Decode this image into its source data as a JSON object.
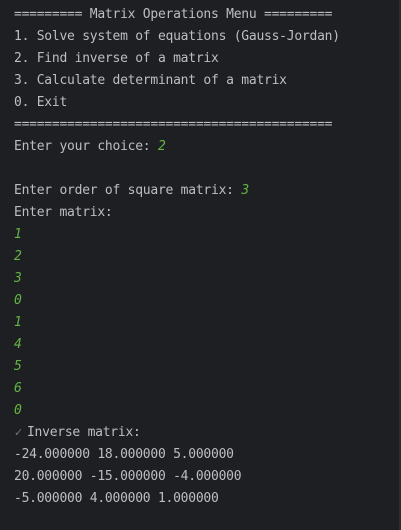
{
  "console": {
    "menu_header": "========= Matrix Operations Menu =========",
    "menu_items": [
      "1. Solve system of equations (Gauss-Jordan)",
      "2. Find inverse of a matrix",
      "3. Calculate determinant of a matrix",
      "0. Exit"
    ],
    "menu_footer": "==========================================",
    "choice_prompt": "Enter your choice: ",
    "choice_value": "2",
    "order_prompt": "Enter order of square matrix: ",
    "order_value": "3",
    "matrix_prompt": "Enter matrix:",
    "matrix_inputs": [
      "1",
      "2",
      "3",
      "0",
      "1",
      "4",
      "5",
      "6",
      "0"
    ],
    "check_icon": "✓",
    "result_label": "Inverse matrix:",
    "result_rows": [
      "-24.000000 18.000000 5.000000",
      "20.000000 -15.000000 -4.000000",
      "-5.000000 4.000000 1.000000"
    ]
  },
  "colors": {
    "background": "#1e1f22",
    "text": "#bcbec4",
    "user_input": "#62b543",
    "check_icon": "#6f737a"
  }
}
